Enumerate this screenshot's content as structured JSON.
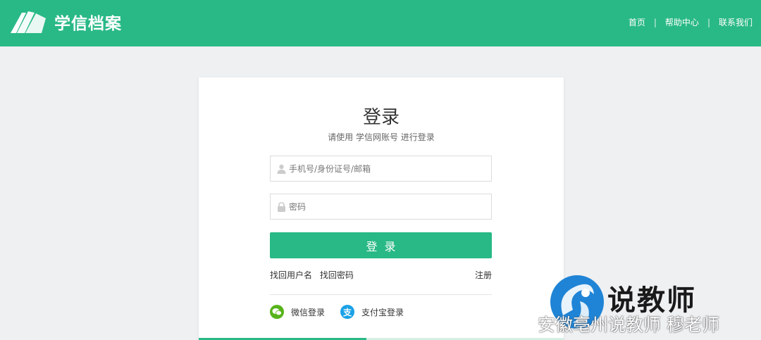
{
  "header": {
    "brand_name": "学信档案",
    "nav": [
      {
        "label": "首页"
      },
      {
        "label": "帮助中心"
      },
      {
        "label": "联系我们"
      }
    ],
    "nav_separator": "|",
    "accent_color": "#29b986"
  },
  "login": {
    "title": "登录",
    "subtitle": "请使用 学信网账号 进行登录",
    "username_placeholder": "手机号/身份证号/邮箱",
    "password_placeholder": "密码",
    "submit_label": "登录",
    "links": {
      "find_username": "找回用户名",
      "find_password": "找回密码",
      "register": "注册"
    },
    "social": {
      "wechat_label": "微信登录",
      "alipay_label": "支付宝登录",
      "alipay_glyph": "支"
    },
    "progress": 0.46
  },
  "watermark": {
    "title": "说教师",
    "caption": "安徽亳州说教师 穆老师"
  },
  "icons": {
    "brand_logo": "book-pages-icon",
    "username": "user-icon",
    "password": "lock-icon",
    "wechat": "wechat-icon",
    "alipay": "alipay-icon",
    "watermark_logo": "swirl-figure-icon",
    "weibo": "weibo-icon"
  }
}
